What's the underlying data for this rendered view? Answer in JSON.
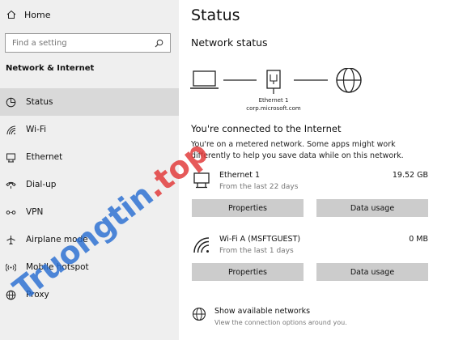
{
  "sidebar": {
    "home_label": "Home",
    "search_placeholder": "Find a setting",
    "section_title": "Network & Internet",
    "items": [
      {
        "label": "Status",
        "icon": "globe-status-icon",
        "active": true
      },
      {
        "label": "Wi-Fi",
        "icon": "wifi-icon",
        "active": false
      },
      {
        "label": "Ethernet",
        "icon": "ethernet-icon",
        "active": false
      },
      {
        "label": "Dial-up",
        "icon": "dialup-icon",
        "active": false
      },
      {
        "label": "VPN",
        "icon": "vpn-icon",
        "active": false
      },
      {
        "label": "Airplane mode",
        "icon": "airplane-icon",
        "active": false
      },
      {
        "label": "Mobile hotspot",
        "icon": "hotspot-icon",
        "active": false
      },
      {
        "label": "Proxy",
        "icon": "globe-icon",
        "active": false
      }
    ]
  },
  "main": {
    "title": "Status",
    "network_status_heading": "Network status",
    "diagram": {
      "adapter_name": "Ethernet 1",
      "domain": "corp.microsoft.com"
    },
    "connected_text": "You're connected to the Internet",
    "metered_text": "You're on a metered network. Some apps might work differently to help you save data while on this network.",
    "connections": [
      {
        "name": "Ethernet 1",
        "sub": "From the last 22 days",
        "size": "19.52 GB",
        "icon": "ethernet-icon",
        "properties_label": "Properties",
        "data_usage_label": "Data usage"
      },
      {
        "name": "Wi-Fi A (MSFTGUEST)",
        "sub": "From the last 1 days",
        "size": "0 MB",
        "icon": "wifi-icon",
        "properties_label": "Properties",
        "data_usage_label": "Data usage"
      }
    ],
    "show_networks": {
      "title": "Show available networks",
      "sub": "View the connection options around you."
    }
  },
  "watermark": {
    "part1": "Truongtin",
    "part2": ".top"
  },
  "colors": {
    "sidebar_bg": "#efefef",
    "active_item_bg": "#d9d9d9",
    "button_bg": "#cccccc",
    "watermark_blue": "#2a6ed2",
    "watermark_red": "#e23c3c"
  }
}
